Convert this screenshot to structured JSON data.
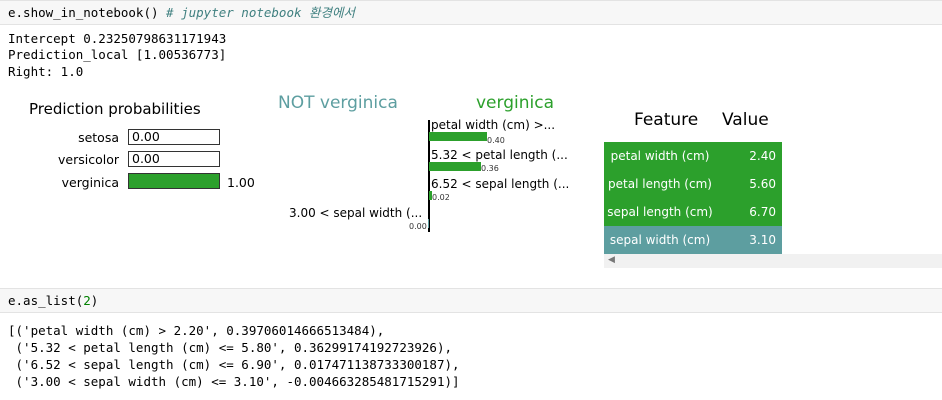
{
  "cell1": {
    "code": "e.show_in_notebook()",
    "comment": "# jupyter notebook 환경에서"
  },
  "output1": {
    "intercept": "Intercept 0.23250798631171943",
    "prediction_local": "Prediction_local [1.00536773]",
    "right": "Right: 1.0"
  },
  "pred_probs": {
    "title": "Prediction probabilities",
    "items": [
      {
        "label": "setosa",
        "value": "0.00",
        "fraction": 0.0
      },
      {
        "label": "versicolor",
        "value": "0.00",
        "fraction": 0.0
      },
      {
        "label": "verginica",
        "value": "1.00",
        "fraction": 1.0
      }
    ],
    "fill_color": "#2ca02c"
  },
  "explanation": {
    "neg_class": "NOT verginica",
    "pos_class": "verginica",
    "neg_color": "#5d9ea0",
    "pos_color": "#2ca02c",
    "features": [
      {
        "label": "petal width (cm) >...",
        "value_label": "0.40",
        "value": 0.4,
        "side": "right"
      },
      {
        "label": "5.32 < petal length (...",
        "value_label": "0.36",
        "value": 0.36,
        "side": "right"
      },
      {
        "label": "6.52 < sepal length (...",
        "value_label": "0.02",
        "value": 0.02,
        "side": "right"
      },
      {
        "label": "3.00 < sepal width (...",
        "value_label": "0.00",
        "value": 0.0,
        "side": "left"
      }
    ]
  },
  "feature_table": {
    "headers": [
      "Feature",
      "Value"
    ],
    "rows": [
      {
        "feature": "petal width (cm)",
        "value": "2.40",
        "color": "#2ca02c"
      },
      {
        "feature": "petal length (cm)",
        "value": "5.60",
        "color": "#2ca02c"
      },
      {
        "feature": "sepal length (cm)",
        "value": "6.70",
        "color": "#2ca02c"
      },
      {
        "feature": "sepal width (cm)",
        "value": "3.10",
        "color": "#5d9ea0"
      }
    ],
    "scroll_icon": "left-arrow-icon"
  },
  "cell2": {
    "code_prefix": "e.as_list(",
    "code_arg": "2",
    "code_suffix": ")"
  },
  "output2": {
    "lines": [
      "[('petal width (cm) > 2.20', 0.39706014666513484),",
      " ('5.32 < petal length (cm) <= 5.80', 0.36299174192723926),",
      " ('6.52 < sepal length (cm) <= 6.90', 0.017471138733300187),",
      " ('3.00 < sepal width (cm) <= 3.10', -0.004663285481715291)]"
    ]
  }
}
